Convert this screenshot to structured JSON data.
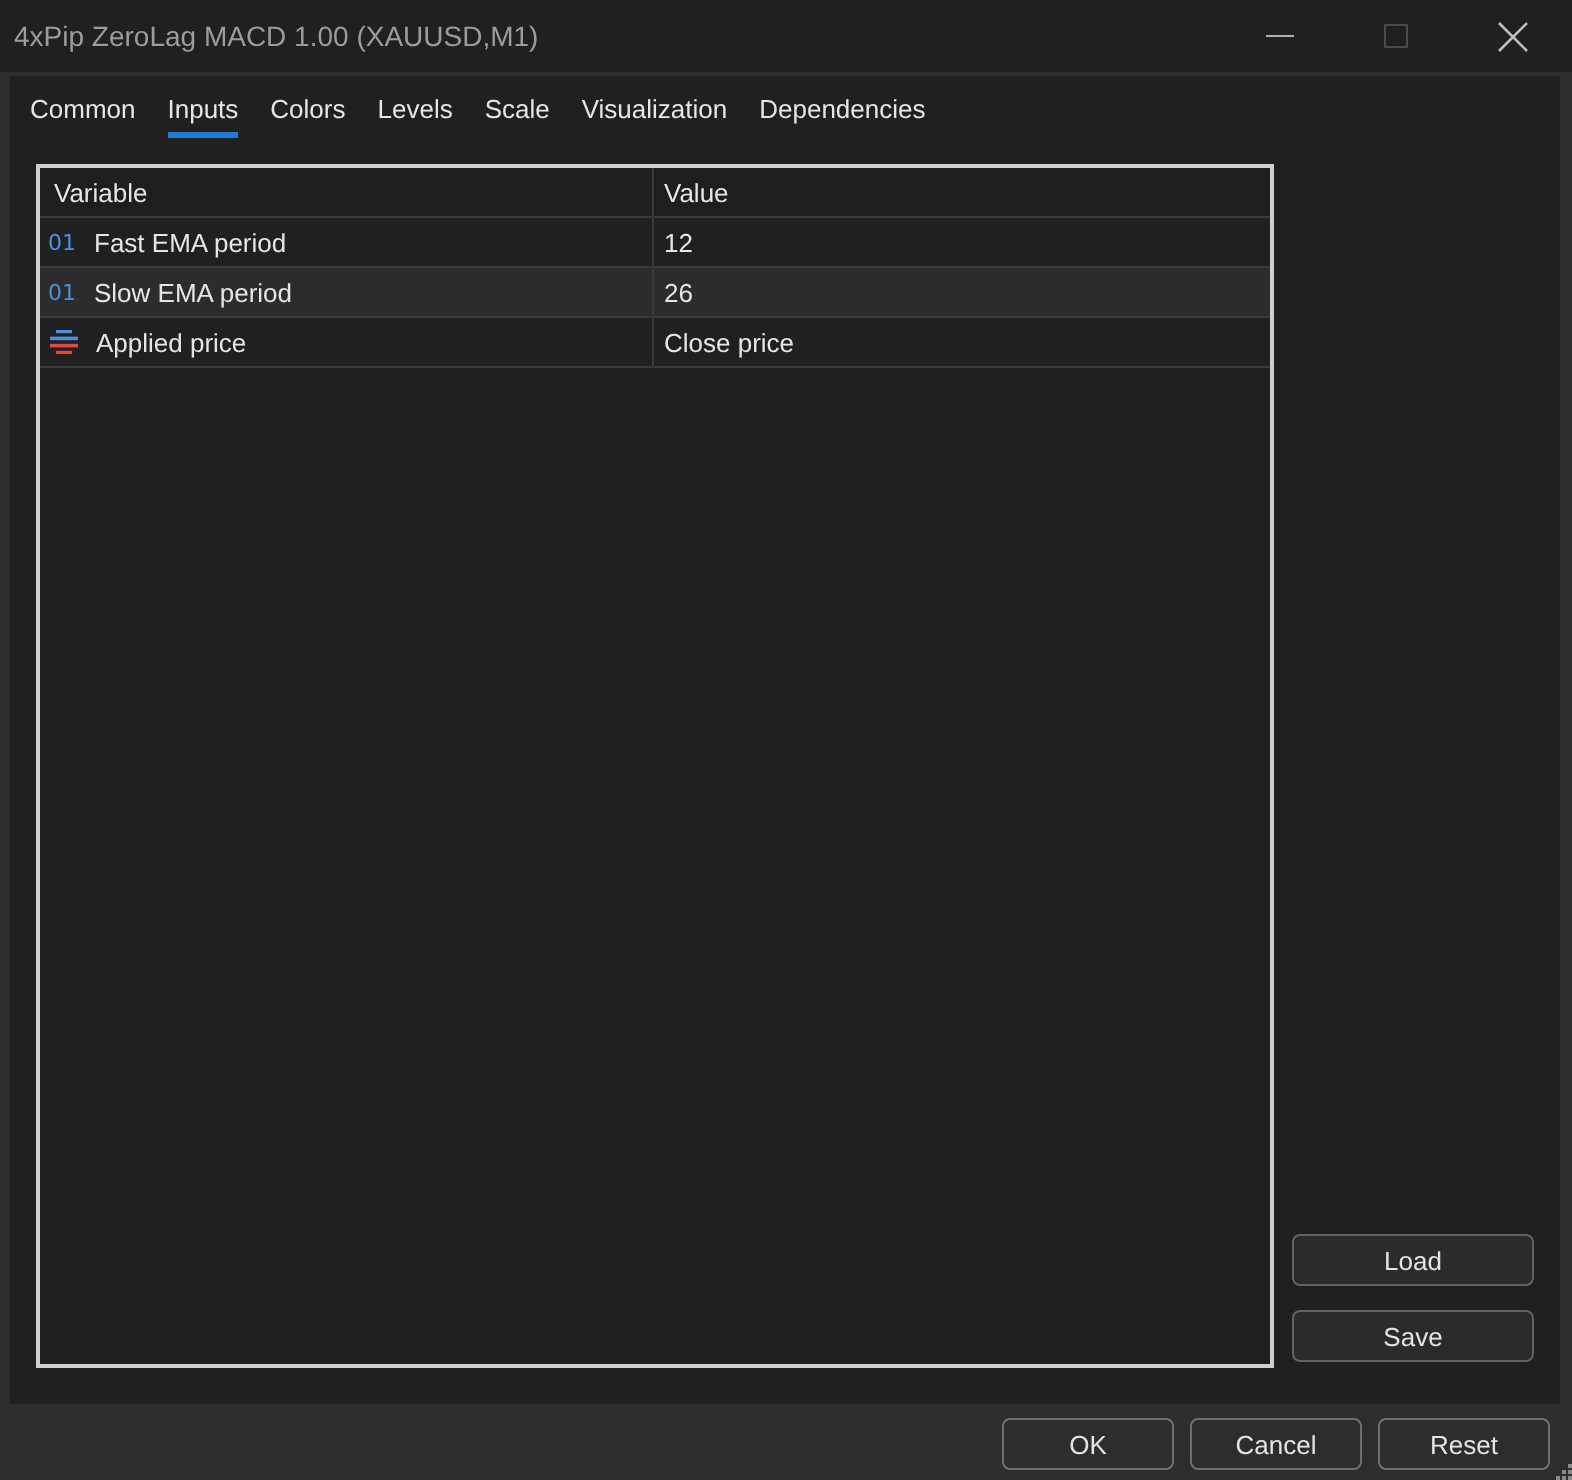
{
  "window": {
    "title": "4xPip ZeroLag MACD 1.00 (XAUUSD,M1)"
  },
  "tabs": [
    {
      "label": "Common",
      "selected": false
    },
    {
      "label": "Inputs",
      "selected": true
    },
    {
      "label": "Colors",
      "selected": false
    },
    {
      "label": "Levels",
      "selected": false
    },
    {
      "label": "Scale",
      "selected": false
    },
    {
      "label": "Visualization",
      "selected": false
    },
    {
      "label": "Dependencies",
      "selected": false
    }
  ],
  "table": {
    "columns": [
      "Variable",
      "Value"
    ],
    "rows": [
      {
        "kind": "integer",
        "type_mark": "01",
        "variable": "Fast EMA period",
        "value": "12",
        "selected": false
      },
      {
        "kind": "integer",
        "type_mark": "01",
        "variable": "Slow EMA period",
        "value": "26",
        "selected": true
      },
      {
        "kind": "enum",
        "variable": "Applied price",
        "value": "Close price",
        "selected": false
      }
    ]
  },
  "side_buttons": [
    "Load",
    "Save"
  ],
  "footer_buttons": [
    "OK",
    "Cancel",
    "Reset"
  ]
}
